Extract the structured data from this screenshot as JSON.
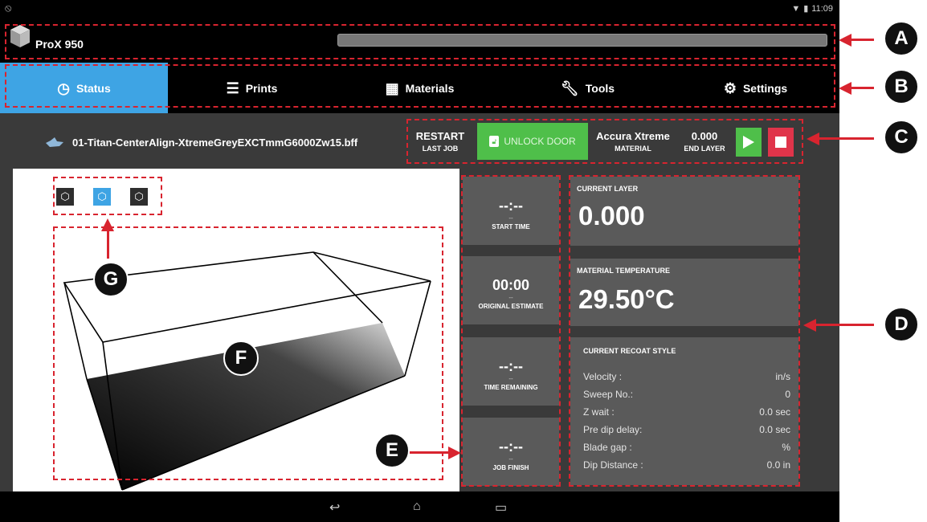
{
  "status_bar": {
    "time": "11:09",
    "wifi_icon": "wifi-icon",
    "battery_icon": "battery-icon"
  },
  "app": {
    "name": "ProX 950",
    "progress": 0.0
  },
  "tabs": [
    {
      "label": "Status",
      "icon": "clock-icon",
      "active": true
    },
    {
      "label": "Prints",
      "icon": "list-icon",
      "active": false
    },
    {
      "label": "Materials",
      "icon": "checker-icon",
      "active": false
    },
    {
      "label": "Tools",
      "icon": "wrench-icon",
      "active": false
    },
    {
      "label": "Settings",
      "icon": "gear-icon",
      "active": false
    }
  ],
  "job": {
    "filename": "01-Titan-CenterAlign-XtremeGreyEXCTmmG6000Zw15.bff",
    "restart_label": "RESTART",
    "restart_sub": "LAST JOB",
    "unlock_label": "UNLOCK DOOR",
    "material_name": "Accura Xtreme",
    "material_sub": "MATERIAL",
    "end_layer_value": "0.000",
    "end_layer_sub": "END LAYER"
  },
  "times": [
    {
      "value": "--:--",
      "dash": "--",
      "label": "START TIME"
    },
    {
      "value": "00:00",
      "dash": "--",
      "label": "ORIGINAL ESTIMATE"
    },
    {
      "value": "--:--",
      "dash": "--",
      "label": "TIME REMAINING"
    },
    {
      "value": "--:--",
      "dash": "--",
      "label": "JOB FINISH"
    }
  ],
  "current_layer": {
    "label": "CURRENT LAYER",
    "value": "0.000"
  },
  "material_temp": {
    "label": "MATERIAL TEMPERATURE",
    "value": "29.50°C"
  },
  "recoat": {
    "label": "CURRENT RECOAT STYLE",
    "rows": [
      {
        "name": "Velocity :",
        "value": "in/s"
      },
      {
        "name": "Sweep No.:",
        "value": "0"
      },
      {
        "name": "Z wait :",
        "value": "0.0 sec"
      },
      {
        "name": "Pre dip delay:",
        "value": "0.0 sec"
      },
      {
        "name": "Blade gap :",
        "value": "%"
      },
      {
        "name": "Dip Distance :",
        "value": "0.0 in"
      }
    ]
  },
  "callouts": [
    "A",
    "B",
    "C",
    "D",
    "E",
    "F",
    "G"
  ],
  "colors": {
    "accent": "#3ea4e4",
    "green": "#4fbf4a",
    "red": "#e0344a",
    "annotation": "#d8242f"
  }
}
